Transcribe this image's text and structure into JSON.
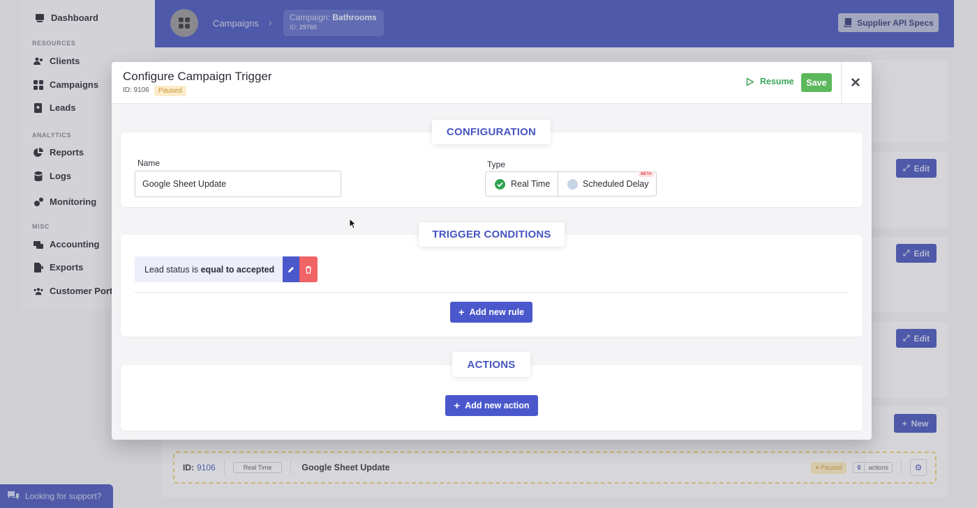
{
  "sidebar": {
    "dashboard": "Dashboard",
    "sections": {
      "resources": "RESOURCES",
      "analytics": "ANALYTICS",
      "misc": "MISC"
    },
    "items": {
      "clients": "Clients",
      "campaigns": "Campaigns",
      "leads": "Leads",
      "reports": "Reports",
      "logs": "Logs",
      "monitoring": "Monitoring",
      "accounting": "Accounting",
      "exports": "Exports",
      "customer_portal": "Customer Porta"
    }
  },
  "header": {
    "breadcrumb_campaigns": "Campaigns",
    "campaign_prefix": "Campaign: ",
    "campaign_name": "Bathrooms",
    "id_prefix": "ID: ",
    "campaign_id": "29760",
    "api_button": "Supplier API Specs"
  },
  "background": {
    "edit_label": "Edit",
    "new_label": "New",
    "row": {
      "id_label": "ID:",
      "id_value": "9106",
      "type_badge": "Real Time",
      "name": "Google Sheet Update",
      "status": "Paused",
      "actions_count": "0",
      "actions_label": "actions"
    },
    "support": "Looking for support?"
  },
  "modal": {
    "title": "Configure Campaign Trigger",
    "id_text": "ID: 9106",
    "status_badge": "Paused",
    "resume_label": "Resume",
    "save_label": "Save",
    "configuration": {
      "title": "CONFIGURATION",
      "name_label": "Name",
      "name_value": "Google Sheet Update",
      "type_label": "Type",
      "type_realtime": "Real Time",
      "type_scheduled": "Scheduled Delay",
      "beta_badge": "BETA"
    },
    "conditions": {
      "title": "TRIGGER CONDITIONS",
      "rule_prefix": "Lead status is ",
      "rule_bold": "equal to accepted",
      "add_rule": "Add new rule"
    },
    "actions": {
      "title": "ACTIONS",
      "add_action": "Add new action"
    }
  },
  "colors": {
    "primary": "#4a58cc",
    "success": "#5cb85c",
    "danger": "#f06466",
    "header": "#3c4bb3"
  }
}
